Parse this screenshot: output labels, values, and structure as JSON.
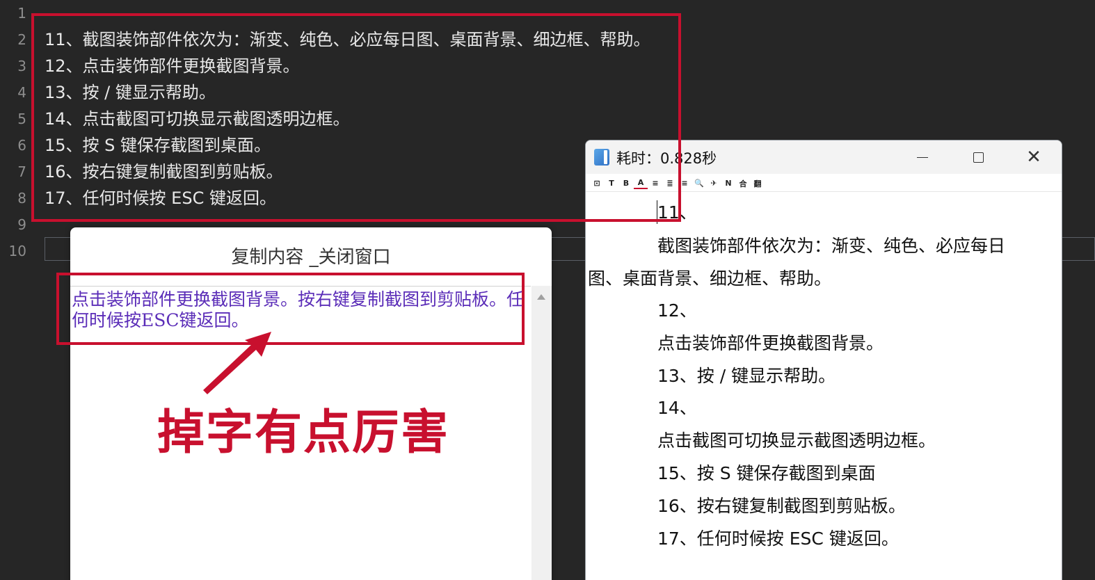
{
  "editor": {
    "line_numbers": [
      "1",
      "2",
      "3",
      "4",
      "5",
      "6",
      "7",
      "8",
      "9",
      "10"
    ],
    "lines": [
      "",
      "11、截图装饰部件依次为：渐变、纯色、必应每日图、桌面背景、细边框、帮助。",
      "12、点击装饰部件更换截图背景。",
      "13、按 / 键显示帮助。",
      "14、点击截图可切换显示截图透明边框。",
      "15、按 S 键保存截图到桌面。",
      "16、按右键复制截图到剪贴板。",
      "17、任何时候按 ESC 键返回。",
      "",
      ""
    ]
  },
  "copy_window": {
    "title": "复制内容 _关闭窗口",
    "content": "点击装饰部件更换截图背景。按右键复制截图到剪贴板。任何时候按ESC键返回。",
    "text_color": "#5b2db8"
  },
  "annotation": {
    "text": "掉字有点厉害",
    "color": "#c8102e"
  },
  "result_window": {
    "title": "耗时：0.828秒",
    "toolbar": [
      "⊡",
      "T",
      "B",
      "A",
      "≡",
      "≣",
      "≡",
      "🔍",
      "✈",
      "N",
      "合",
      "翻"
    ],
    "content_lines": [
      "11、",
      "截图装饰部件依次为：渐变、纯色、必应每日",
      "图、桌面背景、细边框、帮助。",
      "12、",
      "点击装饰部件更换截图背景。",
      "13、按 / 键显示帮助。",
      "14、",
      "点击截图可切换显示截图透明边框。",
      "15、按 S 键保存截图到桌面",
      "16、按右键复制截图到剪贴板。",
      "17、任何时候按 ESC 键返回。"
    ]
  },
  "colors": {
    "highlight_border": "#c8102e",
    "editor_bg": "#262626"
  }
}
